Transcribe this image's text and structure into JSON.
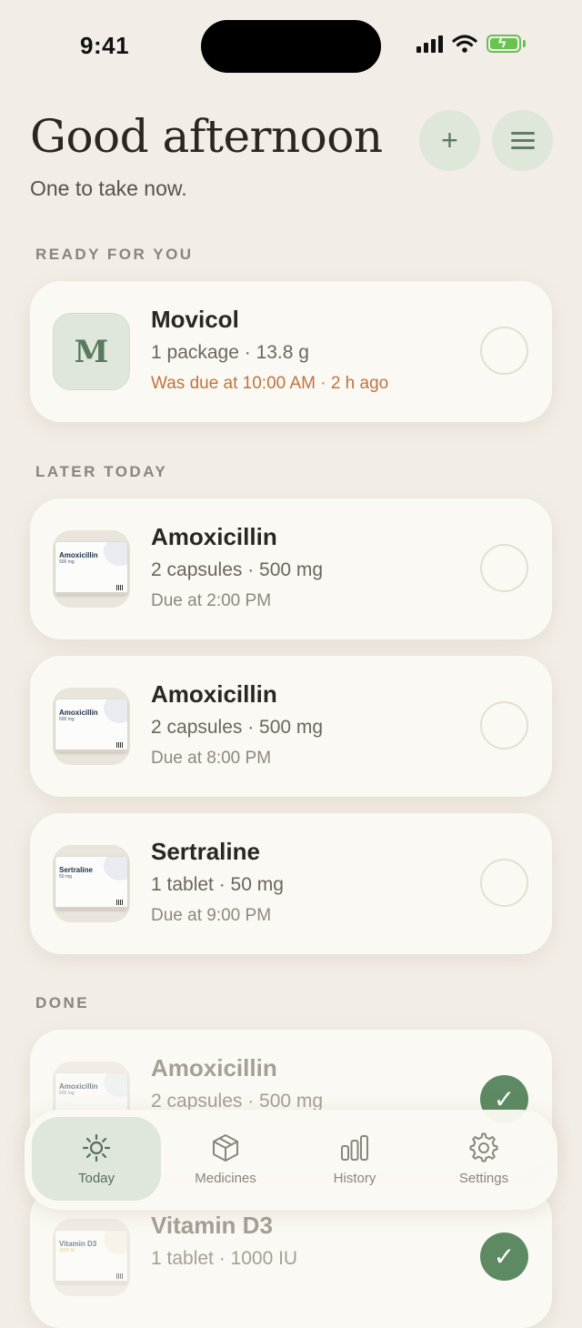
{
  "status_bar": {
    "time": "9:41"
  },
  "header": {
    "greeting": "Good afternoon",
    "subtitle": "One to take now.",
    "add_label": "+"
  },
  "sections": {
    "ready": "READY FOR YOU",
    "later": "LATER TODAY",
    "done": "DONE"
  },
  "ready": [
    {
      "thumb_letter": "M",
      "name": "Movicol",
      "dose": "1 package · 13.8 g",
      "due": "Was due at 10:00 AM · 2 h ago"
    }
  ],
  "later": [
    {
      "name": "Amoxicillin",
      "dose": "2 capsules · 500 mg",
      "due": "Due at 2:00 PM",
      "box_name": "Amoxicillin",
      "box_dose": "500 mg"
    },
    {
      "name": "Amoxicillin",
      "dose": "2 capsules · 500 mg",
      "due": "Due at 8:00 PM",
      "box_name": "Amoxicillin",
      "box_dose": "500 mg"
    },
    {
      "name": "Sertraline",
      "dose": "1 tablet · 50 mg",
      "due": "Due at 9:00 PM",
      "box_name": "Sertraline",
      "box_dose": "50 mg"
    }
  ],
  "done": [
    {
      "name": "Amoxicillin",
      "dose": "2 capsules · 500 mg",
      "box_name": "Amoxicillin",
      "box_dose": "500 mg"
    },
    {
      "name": "Vitamin D3",
      "dose": "1 tablet · 1000 IU",
      "box_name": "Vitamin D3",
      "box_dose": "1000 IU"
    }
  ],
  "tabs": [
    {
      "label": "Today",
      "icon": "sun-icon"
    },
    {
      "label": "Medicines",
      "icon": "box-icon"
    },
    {
      "label": "History",
      "icon": "bar-chart-icon"
    },
    {
      "label": "Settings",
      "icon": "gear-icon"
    }
  ],
  "colors": {
    "background": "#f2ede6",
    "accent": "#5d8a63",
    "overdue": "#c0733f"
  }
}
